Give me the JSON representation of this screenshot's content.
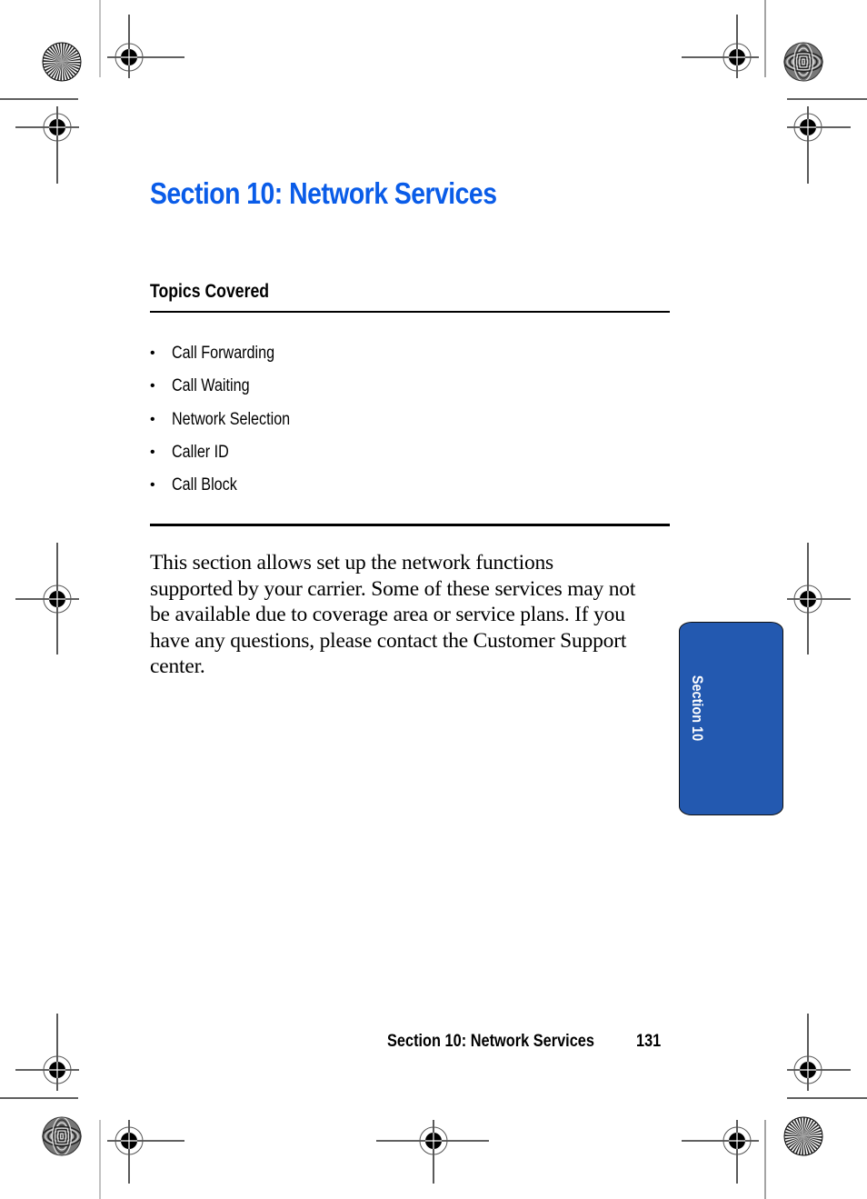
{
  "page": {
    "title": "Section 10: Network Services",
    "topics_heading": "Topics Covered",
    "topics": [
      {
        "label": "Call Forwarding"
      },
      {
        "label": "Call Waiting"
      },
      {
        "label": "Network Selection"
      },
      {
        "label": "Caller ID"
      },
      {
        "label": "Call Block"
      }
    ],
    "bullet_glyph": "•",
    "body_lines": [
      "This section allows set up the network functions",
      "supported by your carrier. Some of these services may not",
      "be available due to coverage area or service plans. If you",
      "have any questions, please contact the Customer Support",
      "center."
    ],
    "side_tab": {
      "label": "Section 10",
      "color": "#2359b0"
    },
    "footer": {
      "section_title": "Section 10: Network Services",
      "page_number": "131"
    }
  },
  "colors": {
    "title": "#0a5ce8",
    "text": "#000000"
  },
  "icons": {
    "registration_mark": "crosshair-target-icon",
    "color_bar_star": "starburst-target-icon",
    "moire_disc": "moire-target-icon"
  }
}
